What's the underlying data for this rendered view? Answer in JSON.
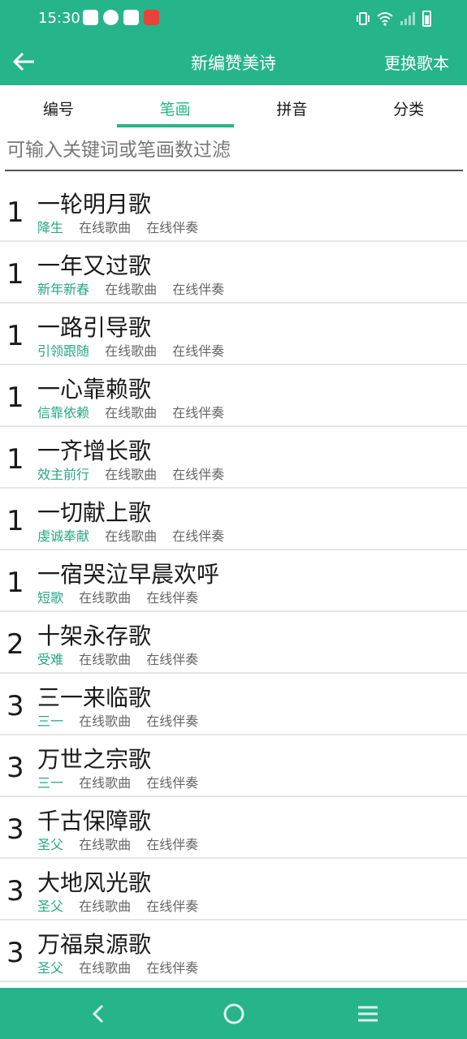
{
  "status_bar": {
    "time": "15:30",
    "left_icons": [
      "mail-icon",
      "clock-app-icon",
      "book-app-icon",
      "red-app-icon"
    ],
    "right_icons": [
      "vibrate-icon",
      "wifi-icon",
      "signal-icon",
      "battery-icon"
    ]
  },
  "app_bar": {
    "back_icon": "back-arrow-icon",
    "title": "新编赞美诗",
    "action": "更换歌本"
  },
  "tabs": [
    {
      "label": "编号",
      "active": false
    },
    {
      "label": "笔画",
      "active": true
    },
    {
      "label": "拼音",
      "active": false
    },
    {
      "label": "分类",
      "active": false
    }
  ],
  "search": {
    "placeholder": "可输入关键词或笔画数过滤",
    "value": ""
  },
  "songs": [
    {
      "strokes": "1",
      "title": "一轮明月歌",
      "category": "降生",
      "online_song": "在线歌曲",
      "online_accomp": "在线伴奏"
    },
    {
      "strokes": "1",
      "title": "一年又过歌",
      "category": "新年新春",
      "online_song": "在线歌曲",
      "online_accomp": "在线伴奏"
    },
    {
      "strokes": "1",
      "title": "一路引导歌",
      "category": "引领跟随",
      "online_song": "在线歌曲",
      "online_accomp": "在线伴奏"
    },
    {
      "strokes": "1",
      "title": "一心靠赖歌",
      "category": "信靠依赖",
      "online_song": "在线歌曲",
      "online_accomp": "在线伴奏"
    },
    {
      "strokes": "1",
      "title": "一齐增长歌",
      "category": "效主前行",
      "online_song": "在线歌曲",
      "online_accomp": "在线伴奏"
    },
    {
      "strokes": "1",
      "title": "一切献上歌",
      "category": "虔诚奉献",
      "online_song": "在线歌曲",
      "online_accomp": "在线伴奏"
    },
    {
      "strokes": "1",
      "title": "一宿哭泣早晨欢呼",
      "category": "短歌",
      "online_song": "在线歌曲",
      "online_accomp": "在线伴奏"
    },
    {
      "strokes": "2",
      "title": "十架永存歌",
      "category": "受难",
      "online_song": "在线歌曲",
      "online_accomp": "在线伴奏"
    },
    {
      "strokes": "3",
      "title": "三一来临歌",
      "category": "三一",
      "online_song": "在线歌曲",
      "online_accomp": "在线伴奏"
    },
    {
      "strokes": "3",
      "title": "万世之宗歌",
      "category": "三一",
      "online_song": "在线歌曲",
      "online_accomp": "在线伴奏"
    },
    {
      "strokes": "3",
      "title": "千古保障歌",
      "category": "圣父",
      "online_song": "在线歌曲",
      "online_accomp": "在线伴奏"
    },
    {
      "strokes": "3",
      "title": "大地风光歌",
      "category": "圣父",
      "online_song": "在线歌曲",
      "online_accomp": "在线伴奏"
    },
    {
      "strokes": "3",
      "title": "万福泉源歌",
      "category": "圣父",
      "online_song": "在线歌曲",
      "online_accomp": "在线伴奏"
    }
  ],
  "nav_bar": {
    "icons": [
      "nav-back-icon",
      "nav-home-icon",
      "nav-menu-icon"
    ]
  },
  "colors": {
    "accent": "#26b48a",
    "category_text": "#26a884",
    "link_text": "#666666"
  }
}
